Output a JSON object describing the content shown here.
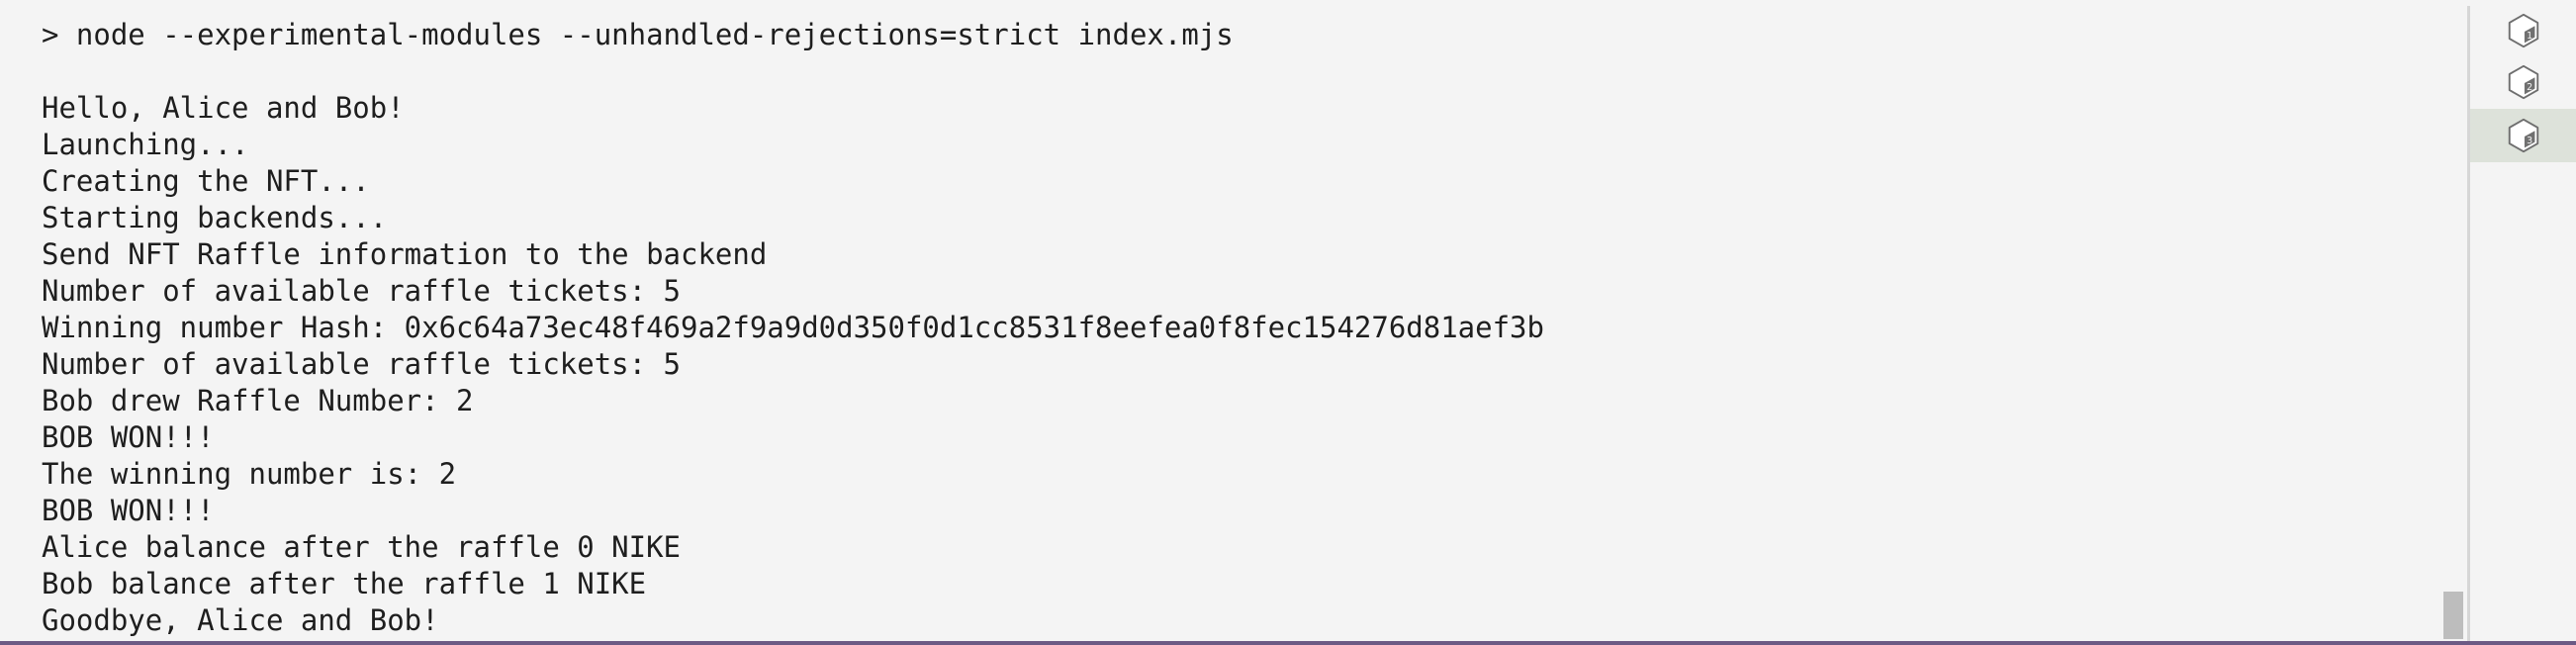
{
  "terminal": {
    "lines": [
      "> node --experimental-modules --unhandled-rejections=strict index.mjs",
      "",
      "Hello, Alice and Bob!",
      "Launching...",
      "Creating the NFT...",
      "Starting backends...",
      "Send NFT Raffle information to the backend",
      "Number of available raffle tickets: 5",
      "Winning number Hash: 0x6c64a73ec48f469a2f9a9d0d350f0d1cc8531f8eefea0f8fec154276d81aef3b",
      "Number of available raffle tickets: 5",
      "Bob drew Raffle Number: 2",
      "BOB WON!!!",
      "The winning number is: 2",
      "BOB WON!!!",
      "Alice balance after the raffle 0 NIKE",
      "Bob balance after the raffle 1 NIKE",
      "Goodbye, Alice and Bob!"
    ]
  },
  "side_panel": {
    "items": [
      {
        "icon": "node-cube-icon",
        "active": false
      },
      {
        "icon": "node-cube-icon",
        "active": false
      },
      {
        "icon": "node-cube-icon",
        "active": true
      }
    ]
  },
  "colors": {
    "background": "#f4f4f4",
    "text": "#1e1e1e",
    "active_item": "#dde2da",
    "bottom_border": "#6c5a84"
  }
}
